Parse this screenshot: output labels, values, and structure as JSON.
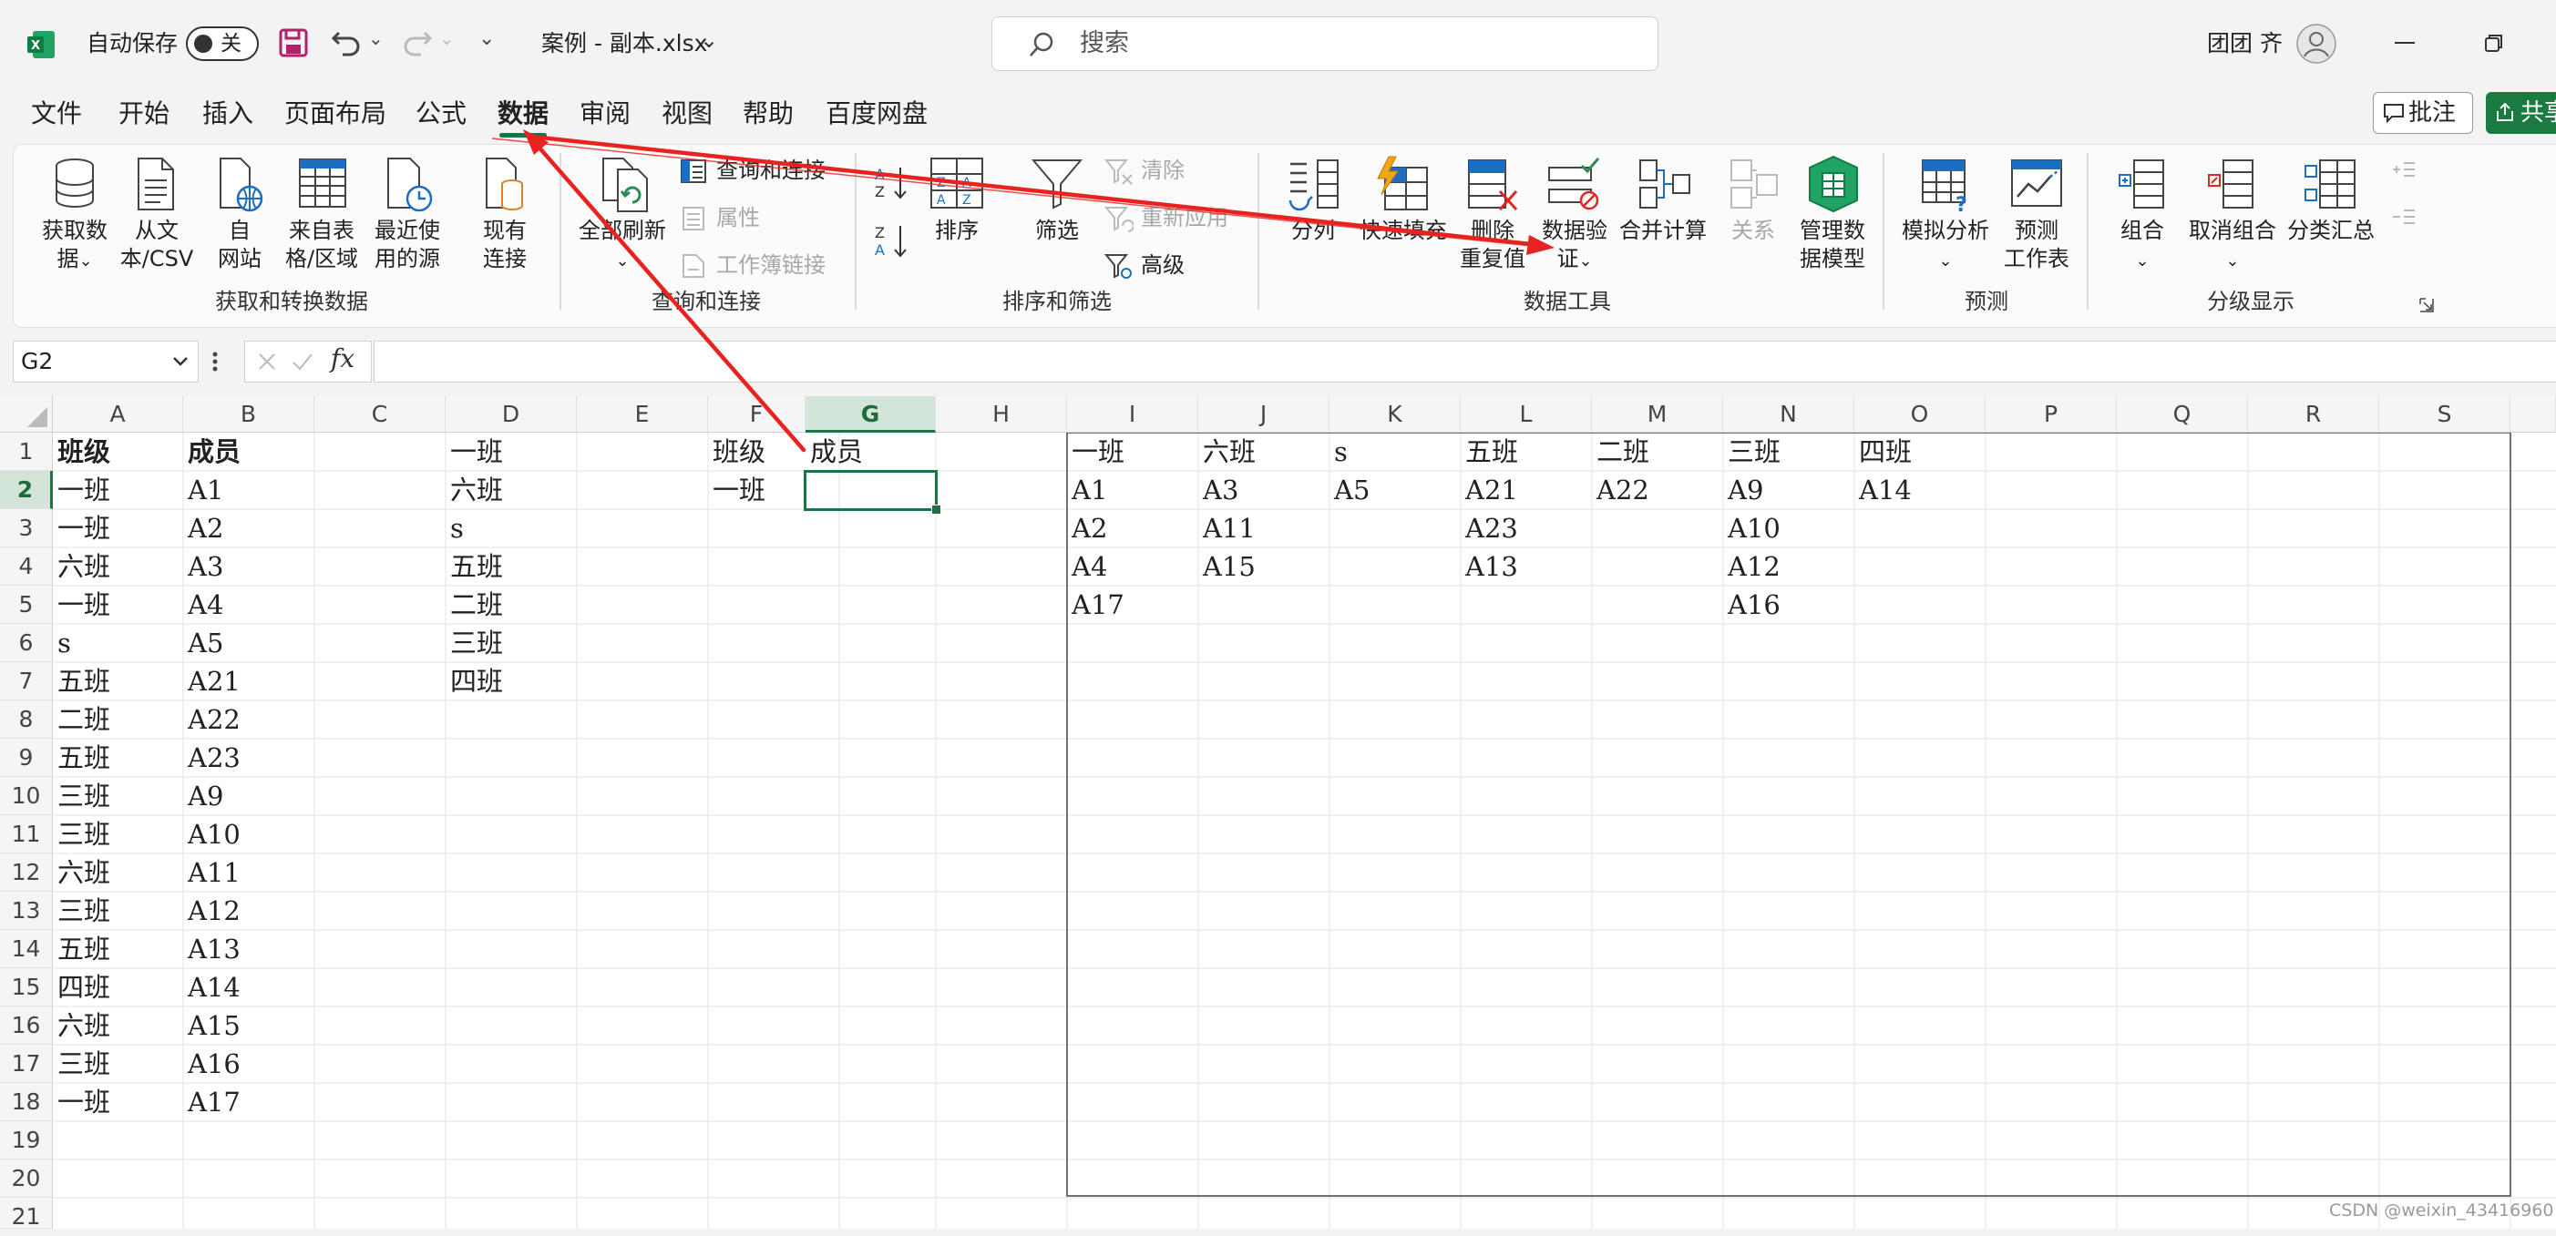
{
  "titlebar": {
    "autosave_label": "自动保存",
    "autosave_toggle": "关",
    "file_name": "案例 - 副本.xlsx",
    "search_placeholder": "搜索",
    "user_name": "团团 齐"
  },
  "menu": [
    "文件",
    "开始",
    "插入",
    "页面布局",
    "公式",
    "数据",
    "审阅",
    "视图",
    "帮助",
    "百度网盘"
  ],
  "menu_active": "数据",
  "actions": {
    "comments": "批注",
    "share": "共享"
  },
  "ribbon": {
    "get_data": {
      "l1": "获取数",
      "l2": "据",
      "chev": "⌄"
    },
    "from_text": {
      "l1": "从文",
      "l2": "本/CSV"
    },
    "from_web": {
      "l1": "自",
      "l2": "网站"
    },
    "from_table": {
      "l1": "来自表",
      "l2": "格/区域"
    },
    "recent": {
      "l1": "最近使",
      "l2": "用的源"
    },
    "existing": {
      "l1": "现有",
      "l2": "连接"
    },
    "group1": "获取和转换数据",
    "refresh_all": {
      "l1": "全部刷新",
      "chev": "⌄"
    },
    "queries": "查询和连接",
    "properties": "属性",
    "workbook_links": "工作簿链接",
    "group2": "查询和连接",
    "sort": "排序",
    "filter": "筛选",
    "clear": "清除",
    "reapply": "重新应用",
    "advanced": "高级",
    "group3": "排序和筛选",
    "text_to_columns": "分列",
    "flash_fill": "快速填充",
    "remove_dup": {
      "l1": "删除",
      "l2": "重复值"
    },
    "data_validation": {
      "l1": "数据验",
      "l2": "证",
      "chev": "⌄"
    },
    "consolidate": "合并计算",
    "relationships": "关系",
    "data_model": {
      "l1": "管理数",
      "l2": "据模型"
    },
    "group4": "数据工具",
    "what_if": {
      "l1": "模拟分析",
      "chev": "⌄"
    },
    "forecast": {
      "l1": "预测",
      "l2": "工作表"
    },
    "group5": "预测",
    "group_btn": {
      "l1": "组合",
      "chev": "⌄"
    },
    "ungroup": {
      "l1": "取消组合",
      "chev": "⌄"
    },
    "subtotal": "分类汇总",
    "group6": "分级显示"
  },
  "formula_bar": {
    "name_box": "G2",
    "fx": "fx",
    "value": ""
  },
  "columns": [
    "A",
    "B",
    "C",
    "D",
    "E",
    "F",
    "G",
    "H",
    "I",
    "J",
    "K",
    "L",
    "M",
    "N",
    "O",
    "P",
    "Q",
    "R",
    "S"
  ],
  "selected_column": "G",
  "selected_row": "2",
  "rows": [
    "1",
    "2",
    "3",
    "4",
    "5",
    "6",
    "7",
    "8",
    "9",
    "10",
    "11",
    "12",
    "13",
    "14",
    "15",
    "16",
    "17",
    "18",
    "19",
    "20",
    "21"
  ],
  "cells": {
    "A": [
      "班级",
      "一班",
      "一班",
      "六班",
      "一班",
      "s",
      "五班",
      "二班",
      "五班",
      "三班",
      "三班",
      "六班",
      "三班",
      "五班",
      "四班",
      "六班",
      "三班",
      "一班"
    ],
    "B": [
      "成员",
      "A1",
      "A2",
      "A3",
      "A4",
      "A5",
      "A21",
      "A22",
      "A23",
      "A9",
      "A10",
      "A11",
      "A12",
      "A13",
      "A14",
      "A15",
      "A16",
      "A17"
    ],
    "D": [
      "一班",
      "六班",
      "s",
      "五班",
      "二班",
      "三班",
      "四班"
    ],
    "F": [
      "班级",
      "一班"
    ],
    "G": [
      "成员",
      ""
    ],
    "I": [
      "一班",
      "A1",
      "A2",
      "A4",
      "A17"
    ],
    "J": [
      "六班",
      "A3",
      "A11",
      "A15"
    ],
    "K": [
      "s",
      "A5"
    ],
    "L": [
      "五班",
      "A21",
      "A23",
      "A13"
    ],
    "M": [
      "二班",
      "A22"
    ],
    "N": [
      "三班",
      "A9",
      "A10",
      "A12",
      "A16"
    ],
    "O": [
      "四班",
      "A14"
    ]
  },
  "watermark": "CSDN @weixin_43416960",
  "colors": {
    "excel_green": "#1e7145",
    "annotation_red": "#e8231f",
    "share_green": "#1b7a3e"
  }
}
